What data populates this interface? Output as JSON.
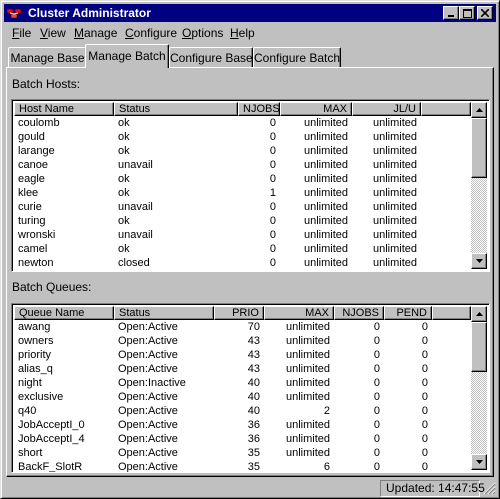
{
  "window": {
    "title": "Cluster Administrator",
    "icon": "app-icon",
    "controls": {
      "minimize": "minimize-icon",
      "maximize": "maximize-icon",
      "close": "close-icon"
    }
  },
  "menubar": {
    "items": [
      {
        "u": "F",
        "rest": "ile"
      },
      {
        "u": "V",
        "rest": "iew"
      },
      {
        "u": "M",
        "rest": "anage"
      },
      {
        "u": "C",
        "rest": "onfigure"
      },
      {
        "u": "O",
        "rest": "ptions"
      },
      {
        "u": "H",
        "rest": "elp"
      }
    ]
  },
  "tabs": [
    {
      "label": "Manage Base",
      "active": false
    },
    {
      "label": "Manage Batch",
      "active": true
    },
    {
      "label": "Configure Base",
      "active": false
    },
    {
      "label": "Configure Batch",
      "active": false
    }
  ],
  "hosts": {
    "label": "Batch Hosts:",
    "columns": [
      "Host Name",
      "Status",
      "NJOBS",
      "MAX",
      "JL/U"
    ],
    "rows": [
      [
        "coulomb",
        "ok",
        "0",
        "unlimited",
        "unlimited"
      ],
      [
        "gould",
        "ok",
        "0",
        "unlimited",
        "unlimited"
      ],
      [
        "larange",
        "ok",
        "0",
        "unlimited",
        "unlimited"
      ],
      [
        "canoe",
        "unavail",
        "0",
        "unlimited",
        "unlimited"
      ],
      [
        "eagle",
        "ok",
        "0",
        "unlimited",
        "unlimited"
      ],
      [
        "klee",
        "ok",
        "1",
        "unlimited",
        "unlimited"
      ],
      [
        "curie",
        "unavail",
        "0",
        "unlimited",
        "unlimited"
      ],
      [
        "turing",
        "ok",
        "0",
        "unlimited",
        "unlimited"
      ],
      [
        "wronski",
        "unavail",
        "0",
        "unlimited",
        "unlimited"
      ],
      [
        "camel",
        "ok",
        "0",
        "unlimited",
        "unlimited"
      ],
      [
        "newton",
        "closed",
        "0",
        "unlimited",
        "unlimited"
      ]
    ]
  },
  "queues": {
    "label": "Batch Queues:",
    "columns": [
      "Queue Name",
      "Status",
      "PRIO",
      "MAX",
      "NJOBS",
      "PEND"
    ],
    "rows": [
      [
        "awang",
        "Open:Active",
        "70",
        "unlimited",
        "0",
        "0"
      ],
      [
        "owners",
        "Open:Active",
        "43",
        "unlimited",
        "0",
        "0"
      ],
      [
        "priority",
        "Open:Active",
        "43",
        "unlimited",
        "0",
        "0"
      ],
      [
        "alias_q",
        "Open:Active",
        "43",
        "unlimited",
        "0",
        "0"
      ],
      [
        "night",
        "Open:Inactive",
        "40",
        "unlimited",
        "0",
        "0"
      ],
      [
        "exclusive",
        "Open:Active",
        "40",
        "unlimited",
        "0",
        "0"
      ],
      [
        "q40",
        "Open:Active",
        "40",
        "2",
        "0",
        "0"
      ],
      [
        "JobAcceptI_0",
        "Open:Active",
        "36",
        "unlimited",
        "0",
        "0"
      ],
      [
        "JobAcceptI_4",
        "Open:Active",
        "36",
        "unlimited",
        "0",
        "0"
      ],
      [
        "short",
        "Open:Active",
        "35",
        "unlimited",
        "0",
        "0"
      ],
      [
        "BackF_SlotR",
        "Open:Active",
        "35",
        "6",
        "0",
        "0"
      ]
    ]
  },
  "status": {
    "updated": "Updated: 14:47:55"
  },
  "colors": {
    "titlebar": "#000080",
    "face": "#c0c0c0"
  }
}
